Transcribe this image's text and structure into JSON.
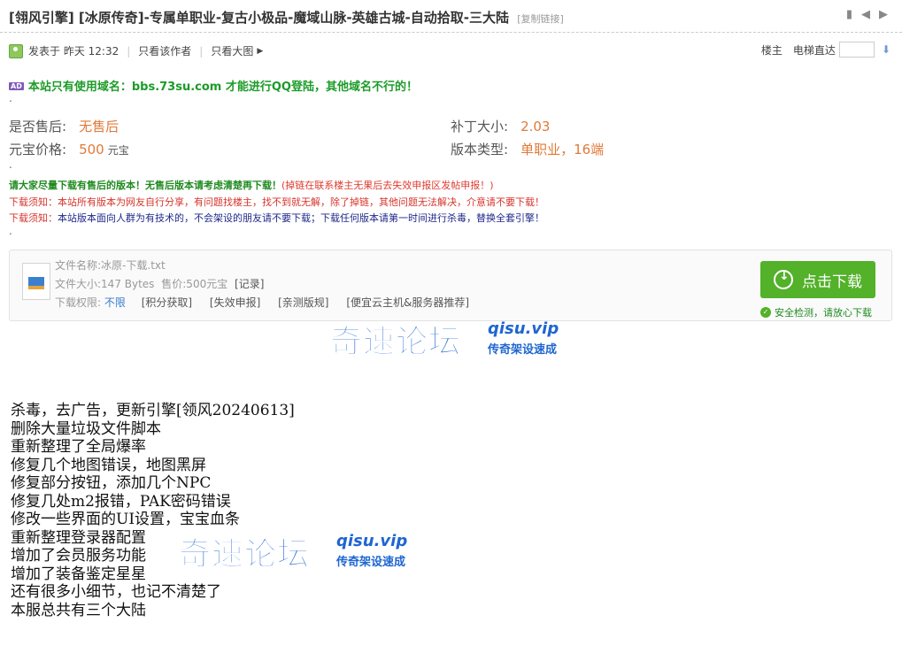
{
  "header": {
    "title": "[翎风引擎] [冰原传奇]-专属单职业-复古小极品-魔域山脉-英雄古城-自动拾取-三大陆",
    "copy_link": "[复制链接]"
  },
  "meta": {
    "posted": "发表于 昨天 12:32",
    "only_author": "只看该作者",
    "only_big": "只看大图",
    "floor_owner": "楼主",
    "elevator": "电梯直达",
    "elevator_input": ""
  },
  "ad_text": "本站只有使用域名：bbs.73su.com 才能进行QQ登陆，其他域名不行的！",
  "ad_badge": "AD",
  "dot": ".",
  "info": {
    "after_sale_label": "是否售后:",
    "after_sale_value": "无售后",
    "patch_size_label": "补丁大小:",
    "patch_size_value": "2.03",
    "price_label": "元宝价格:",
    "price_value": "500",
    "price_unit": "元宝",
    "version_label": "版本类型:",
    "version_value": "单职业，16端"
  },
  "notices": {
    "line1_green": "请大家尽量下载有售后的版本！无售后版本请考虑清楚再下载！",
    "line1_red": "(掉链在联系楼主无果后去失效申报区发帖申报！)",
    "line2": "下载须知：本站所有版本为网友自行分享，有问题找楼主，找不到就无解，除了掉链，其他问题无法解决，介意请不要下载！",
    "line3_red": "下载须知：",
    "line3_blue": "本站版本面向人群为有技术的，不会架设的朋友请不要下载；下载任何版本请第一时间进行杀毒，替换全套引擎！"
  },
  "download": {
    "file_name": "文件名称:冰原-下载.txt",
    "file_size": "文件大小:147 Bytes",
    "price": "售价:500元宝",
    "record": "[记录]",
    "perm_label": "下载权限:",
    "perm_value": "不限",
    "link1": "[积分获取]",
    "link2": "[失效申报]",
    "link3": "[亲测版规]",
    "link4": "[便宜云主机&服务器推荐]",
    "button": "点击下载",
    "safe": "安全检测，请放心下载"
  },
  "watermark": {
    "cn": "奇速论坛",
    "en": "qisu.vip",
    "sub": "传奇架设速成"
  },
  "changelog": [
    "杀毒，去广告，更新引擎[领风20240613]",
    "删除大量垃圾文件脚本",
    "重新整理了全局爆率",
    "修复几个地图错误，地图黑屏",
    "修复部分按钮，添加几个NPC",
    "修复几处m2报错，PAK密码错误",
    "修改一些界面的UI设置，宝宝血条",
    "重新整理登录器配置",
    "增加了会员服务功能",
    "增加了装备鉴定星星",
    "还有很多小细节，也记不清楚了",
    "本服总共有三个大陆"
  ]
}
